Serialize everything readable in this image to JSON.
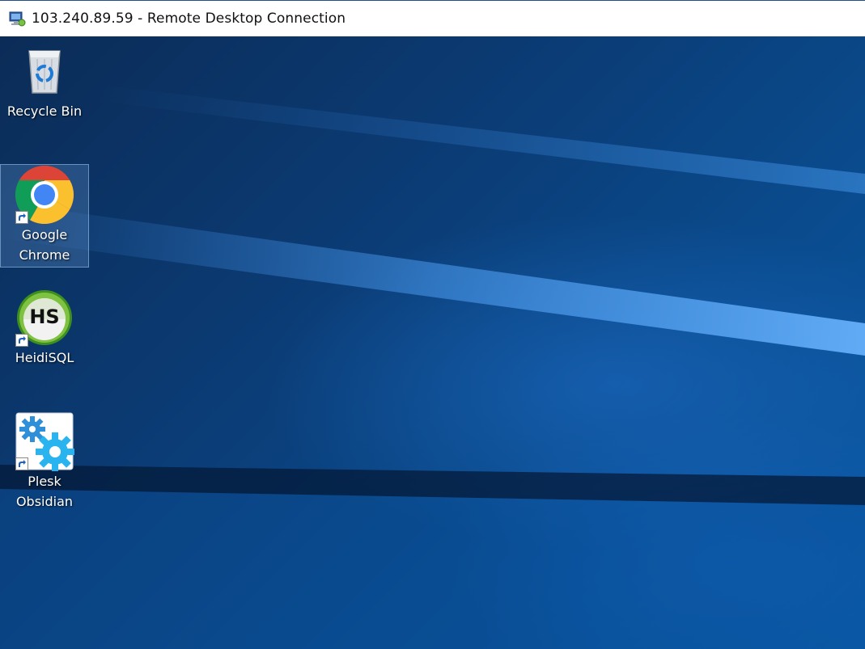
{
  "window": {
    "title": "103.240.89.59 - Remote Desktop Connection",
    "icon": "remote-desktop-icon"
  },
  "desktop": {
    "items": [
      {
        "label": "Recycle Bin",
        "icon": "recycle-bin-icon",
        "shortcut": false,
        "selected": false
      },
      {
        "label": "Google Chrome",
        "icon": "chrome-icon",
        "shortcut": true,
        "selected": true
      },
      {
        "label": "HeidiSQL",
        "icon": "heidisql-icon",
        "shortcut": true,
        "selected": false
      },
      {
        "label": "Plesk Obsidian",
        "icon": "plesk-icon",
        "shortcut": true,
        "selected": false
      }
    ],
    "heidisql_badge": "HS"
  },
  "colors": {
    "desktop_dark": "#0b2c57",
    "desktop_light": "#0a5aa8",
    "selection": "#78aae6"
  }
}
